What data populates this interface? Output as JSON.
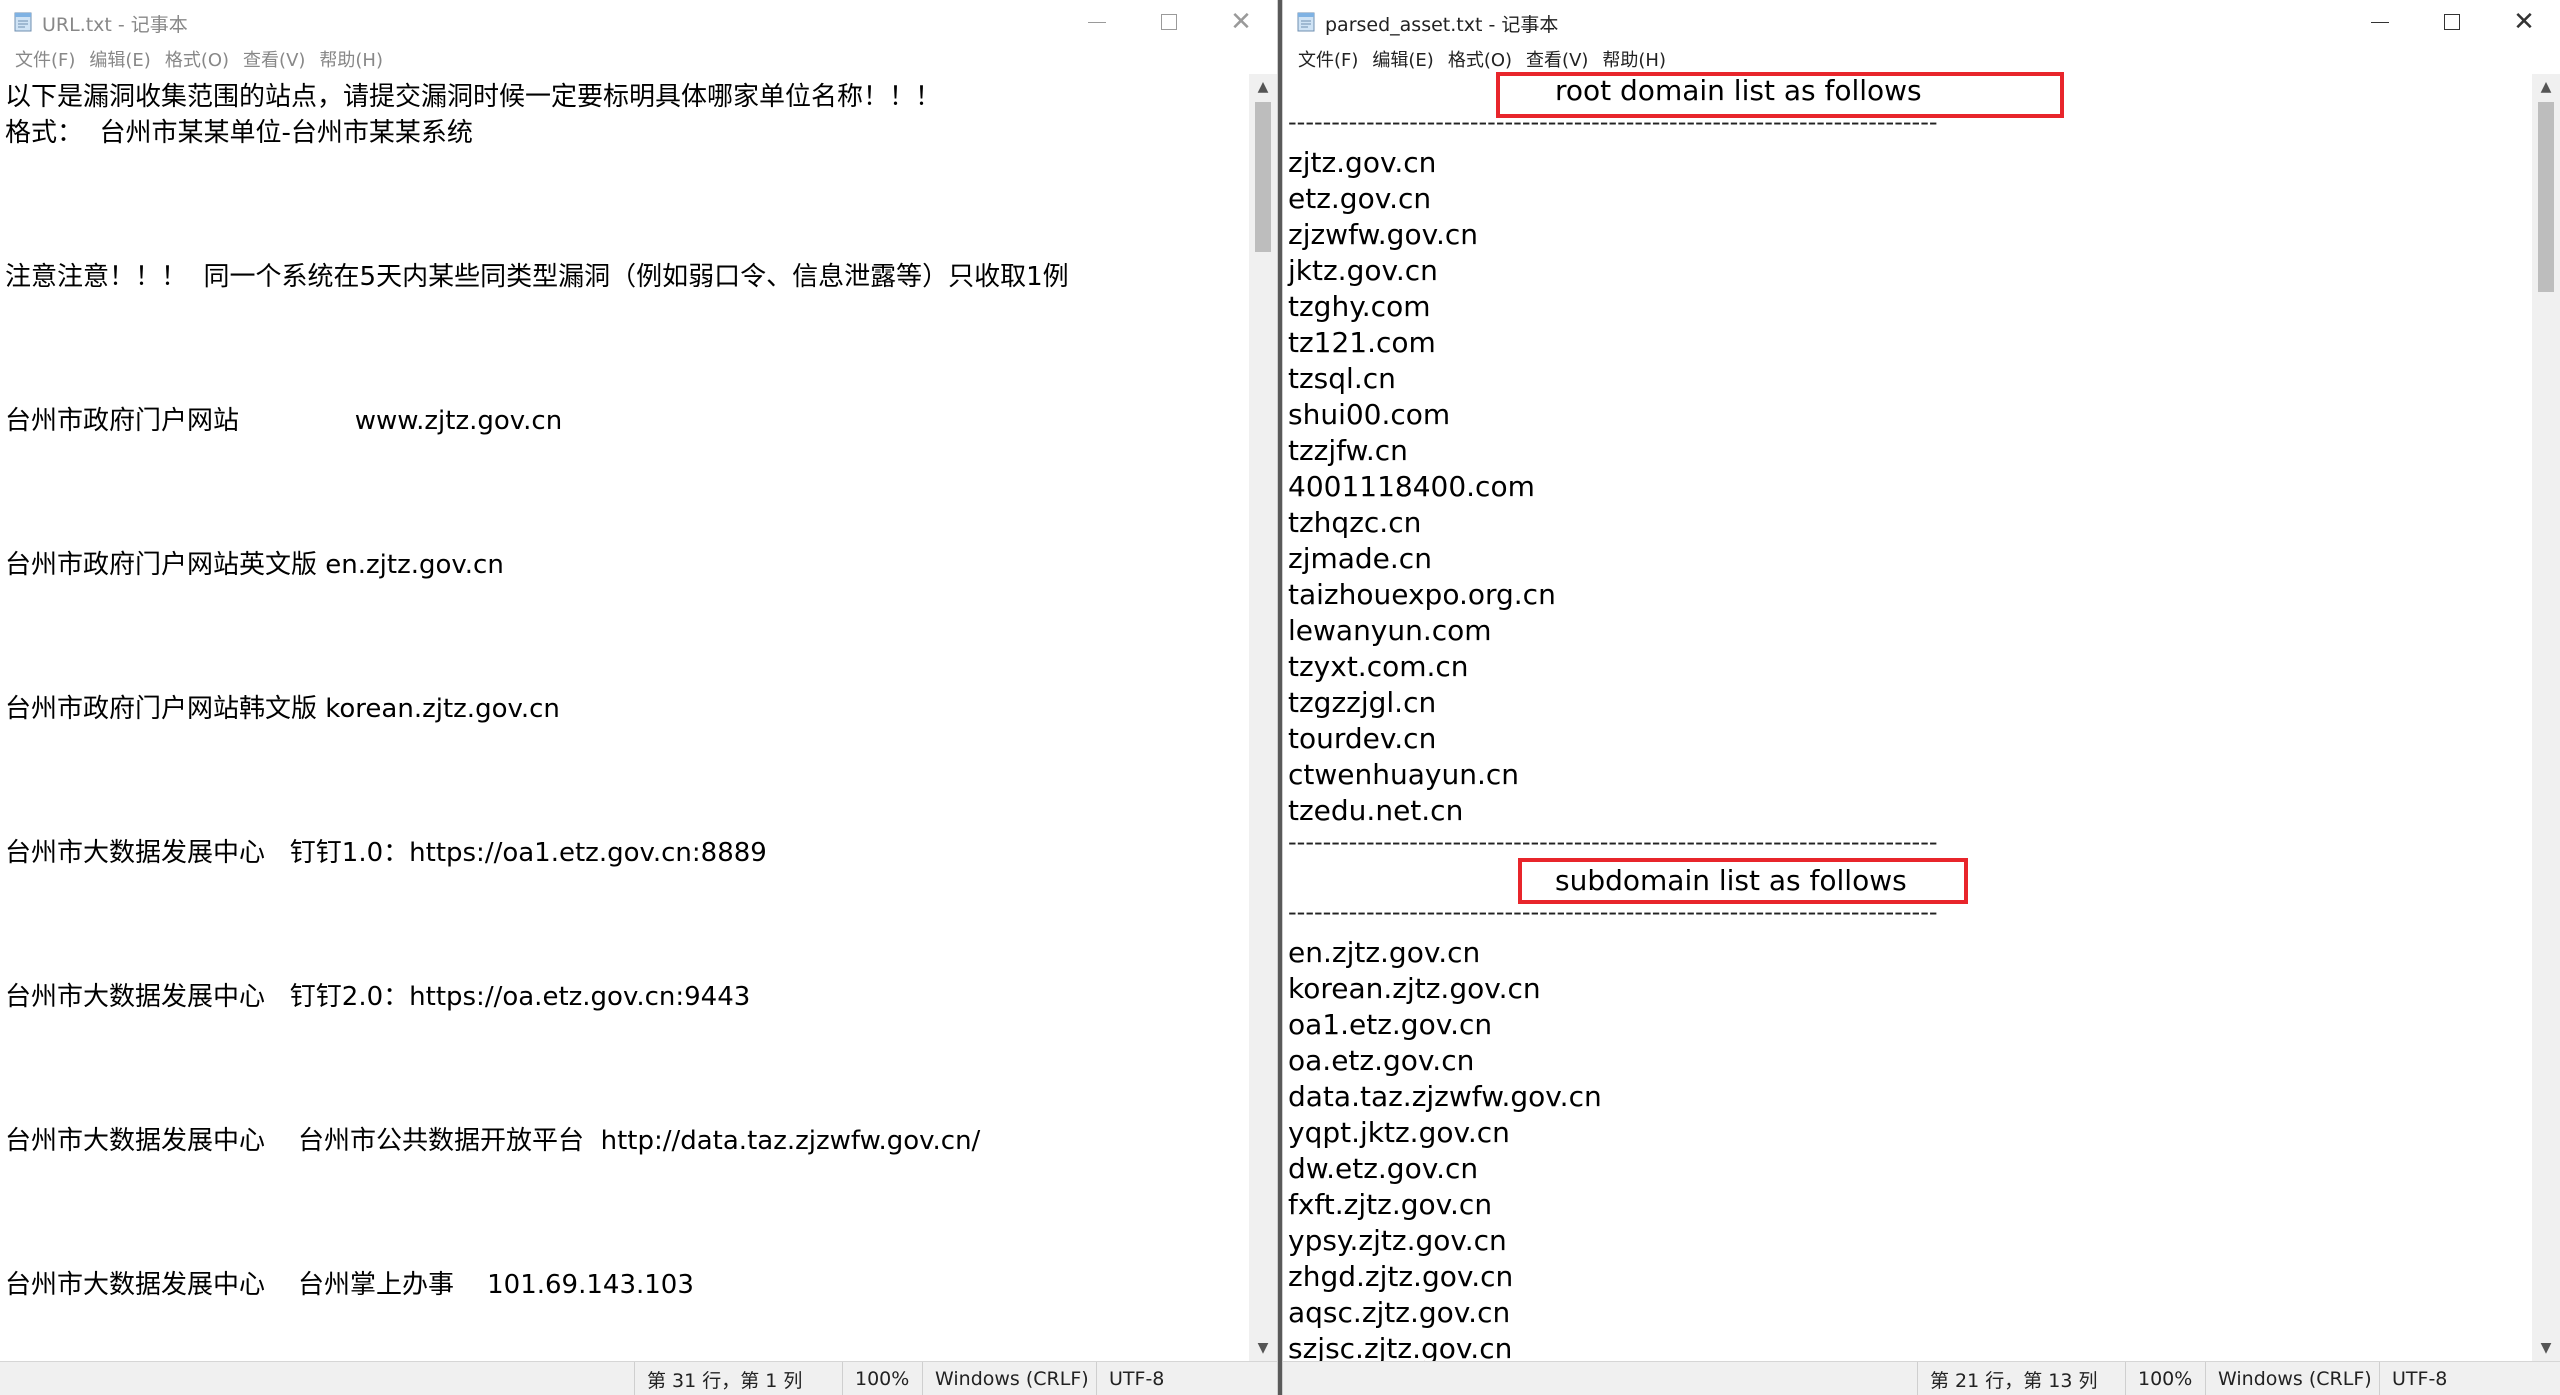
{
  "left_window": {
    "title": "URL.txt - 记事本",
    "menu": [
      "文件(F)",
      "编辑(E)",
      "格式(O)",
      "查看(V)",
      "帮助(H)"
    ],
    "lines": [
      "以下是漏洞收集范围的站点，请提交漏洞时候一定要标明具体哪家单位名称！！！",
      "格式：  台州市某某单位-台州市某某系统",
      "注意注意！！！  同一个系统在5天内某些同类型漏洞（例如弱口令、信息泄露等）只收取1例",
      "台州市政府门户网站              www.zjtz.gov.cn",
      "台州市政府门户网站英文版 en.zjtz.gov.cn",
      "台州市政府门户网站韩文版 korean.zjtz.gov.cn",
      "台州市大数据发展中心   钉钉1.0：https://oa1.etz.gov.cn:8889",
      "台州市大数据发展中心   钉钉2.0：https://oa.etz.gov.cn:9443",
      "台州市大数据发展中心    台州市公共数据开放平台  http://data.taz.zjzwfw.gov.cn/",
      "台州市大数据发展中心    台州掌上办事    101.69.143.103"
    ],
    "status": {
      "position": "第 31 行，第 1 列",
      "zoom": "100%",
      "line_ending": "Windows (CRLF)",
      "encoding": "UTF-8"
    }
  },
  "right_window": {
    "title": "parsed_asset.txt - 记事本",
    "menu": [
      "文件(F)",
      "编辑(E)",
      "格式(O)",
      "查看(V)",
      "帮助(H)"
    ],
    "root_header": "root domain list as follows",
    "separator": "---------------------------------------------------------------------------",
    "root_domains": [
      "zjtz.gov.cn",
      "etz.gov.cn",
      "zjzwfw.gov.cn",
      "jktz.gov.cn",
      "tzghy.com",
      "tz121.com",
      "tzsql.cn",
      "shui00.com",
      "tzzjfw.cn",
      "4001118400.com",
      "tzhqzc.cn",
      "zjmade.cn",
      "taizhouexpo.org.cn",
      "lewanyun.com",
      "tzyxt.com.cn",
      "tzgzzjgl.cn",
      "tourdev.cn",
      "ctwenhuayun.cn",
      "tzedu.net.cn"
    ],
    "sub_header": "subdomain list as follows",
    "subdomains": [
      "en.zjtz.gov.cn",
      "korean.zjtz.gov.cn",
      "oa1.etz.gov.cn",
      "oa.etz.gov.cn",
      "data.taz.zjzwfw.gov.cn",
      "yqpt.jktz.gov.cn",
      "dw.etz.gov.cn",
      "fxft.zjtz.gov.cn",
      "ypsy.zjtz.gov.cn",
      "zhgd.zjtz.gov.cn",
      "aqsc.zjtz.gov.cn",
      "szjsc.zjtz.gov.cn"
    ],
    "status": {
      "position": "第 21 行，第 13 列",
      "zoom": "100%",
      "line_ending": "Windows (CRLF)",
      "encoding": "UTF-8"
    }
  },
  "colors": {
    "highlight": "#e8252b",
    "statusbar": "#f0f0f0"
  },
  "icons": {
    "app": "notepad-icon",
    "minimize": "minimize-icon",
    "maximize": "maximize-icon",
    "close": "close-icon"
  }
}
